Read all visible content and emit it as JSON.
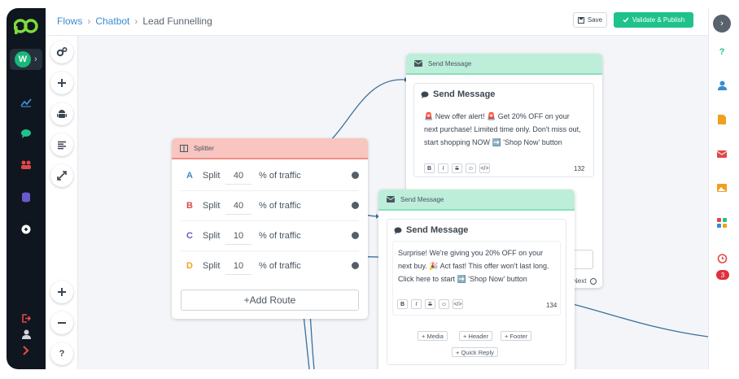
{
  "app": {
    "workspace_initial": "W"
  },
  "breadcrumb": {
    "items": [
      "Flows",
      "Chatbot",
      "Lead Funnelling"
    ]
  },
  "actions": {
    "save_label": "Save",
    "publish_label": "Validate & Publish"
  },
  "splitter": {
    "title": "Splitter",
    "routes": [
      {
        "letter": "A",
        "color": "#3b8bd0",
        "label": "Split",
        "value": "40",
        "suffix": "% of traffic"
      },
      {
        "letter": "B",
        "color": "#e04848",
        "label": "Split",
        "value": "40",
        "suffix": "% of traffic"
      },
      {
        "letter": "C",
        "color": "#6a5acd",
        "label": "Split",
        "value": "10",
        "suffix": "% of traffic"
      },
      {
        "letter": "D",
        "color": "#f0a020",
        "label": "Split",
        "value": "10",
        "suffix": "% of traffic"
      }
    ],
    "add_route_label": "+Add Route"
  },
  "message1": {
    "header": "Send Message",
    "title": "Send Message",
    "text": "🚨 New offer alert! 🚨 Get 20% OFF on your next purchase! Limited time only. Don't miss out, start shopping NOW ➡️ 'Shop Now' button",
    "count": "132",
    "next_label": "Next"
  },
  "message2": {
    "header": "Send Message",
    "title": "Send Message",
    "text": "Surprise! We're giving you 20% OFF on your next buy. 🎉 Act fast! This offer won't last long. Click here to start ➡️ 'Shop Now' button",
    "count": "134",
    "media_label": "+ Media",
    "header_label": "+ Header",
    "footer_label": "+ Footer",
    "quick_reply_label": "+ Quick Reply"
  },
  "format_buttons": [
    "B",
    "I",
    "S",
    "☺",
    "</>"
  ],
  "rightbar": {
    "help": "?",
    "badge": "3"
  },
  "toolbar": {
    "help": "?"
  },
  "colors": {
    "accent": "#1fc28a",
    "link": "#3b8bd0",
    "splitter_header": "#f8c5c0",
    "message_header": "#bdeed9"
  }
}
